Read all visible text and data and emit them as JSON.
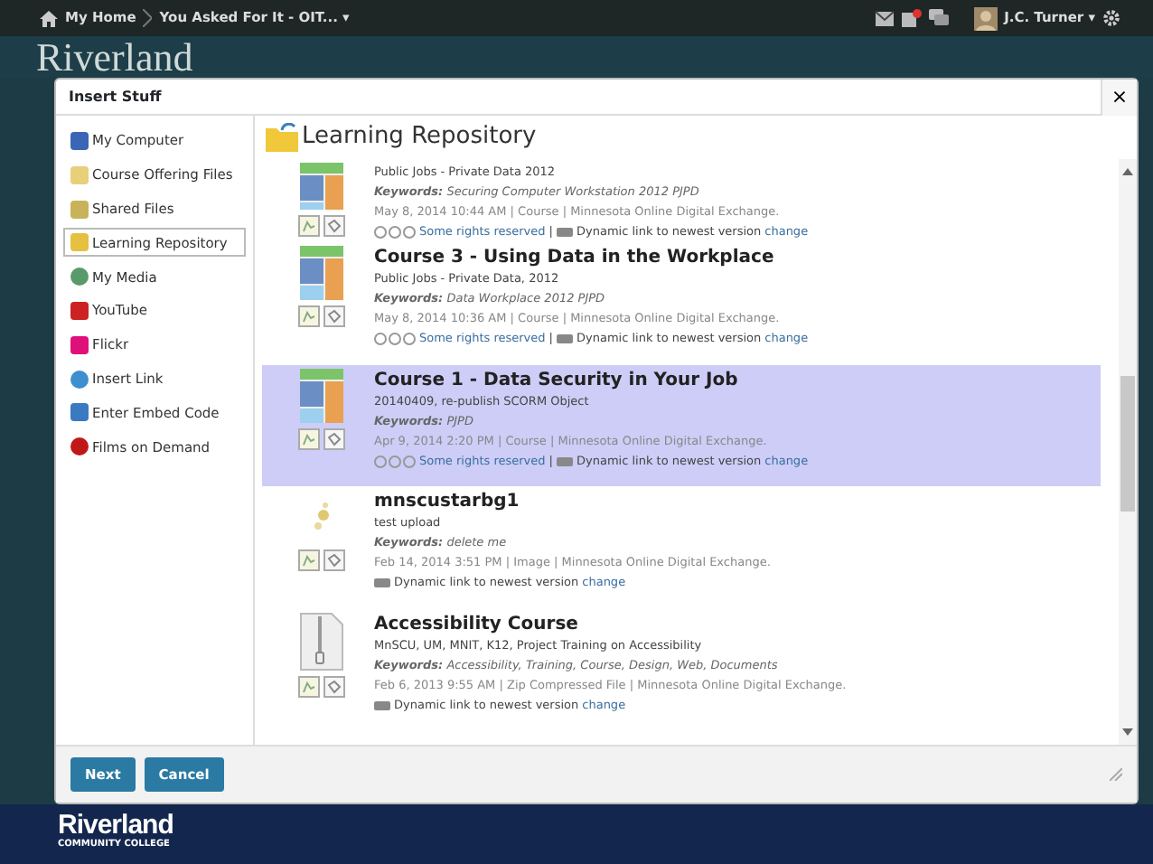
{
  "top_bar": {
    "home": "My Home",
    "course": "You Asked For It - OIT...",
    "caret": "▾",
    "user": "J.C. Turner",
    "user_caret": "▾"
  },
  "header": {
    "logo": "Riverland"
  },
  "dialog": {
    "title": "Insert Stuff",
    "close": "×",
    "sources": [
      {
        "label": "My Computer",
        "selected": false
      },
      {
        "label": "Course Offering Files",
        "selected": false
      },
      {
        "label": "Shared Files",
        "selected": false
      },
      {
        "label": "Learning Repository",
        "selected": true
      },
      {
        "label": "My Media",
        "selected": false
      },
      {
        "label": "YouTube",
        "selected": false
      },
      {
        "label": "Flickr",
        "selected": false
      },
      {
        "label": "Insert Link",
        "selected": false
      },
      {
        "label": "Enter Embed Code",
        "selected": false
      },
      {
        "label": "Films on Demand",
        "selected": false
      }
    ],
    "heading": "Learning Repository",
    "items": [
      {
        "kind": "course",
        "selected": false,
        "description": "Public Jobs - Private Data 2012",
        "keywords_label": "Keywords:",
        "keywords": "Securing Computer Workstation 2012 PJPD",
        "meta": "May 8, 2014 10:44 AM | Course | Minnesota Online Digital Exchange.",
        "rights": "Some rights reserved",
        "separator": "|",
        "link": "Dynamic link to newest version",
        "change": "change"
      },
      {
        "kind": "course",
        "selected": false,
        "title": "Course 3 - Using Data in the Workplace",
        "description": "Public Jobs - Private Data, 2012",
        "keywords_label": "Keywords:",
        "keywords": "Data Workplace 2012 PJPD",
        "meta": "May 8, 2014 10:36 AM | Course | Minnesota Online Digital Exchange.",
        "rights": "Some rights reserved",
        "separator": "|",
        "link": "Dynamic link to newest version",
        "change": "change"
      },
      {
        "kind": "course",
        "selected": true,
        "title": "Course 1 - Data Security in Your Job",
        "description": "20140409, re-publish SCORM Object",
        "keywords_label": "Keywords:",
        "keywords": "PJPD",
        "meta": "Apr 9, 2014 2:20 PM | Course | Minnesota Online Digital Exchange.",
        "rights": "Some rights reserved",
        "separator": "|",
        "link": "Dynamic link to newest version",
        "change": "change"
      },
      {
        "kind": "image",
        "selected": false,
        "title": "mnscustarbg1",
        "description": "test upload",
        "keywords_label": "Keywords:",
        "keywords": "delete me",
        "meta": "Feb 14, 2014 3:51 PM | Image | Minnesota Online Digital Exchange.",
        "link": "Dynamic link to newest version",
        "change": "change"
      },
      {
        "kind": "zip",
        "selected": false,
        "title": "Accessibility Course",
        "description": "MnSCU, UM, MNIT, K12, Project Training on Accessibility",
        "keywords_label": "Keywords:",
        "keywords": "Accessibility, Training, Course, Design, Web, Documents",
        "meta": "Feb 6, 2013 9:55 AM | Zip Compressed File | Minnesota Online Digital Exchange.",
        "link": "Dynamic link to newest version",
        "change": "change"
      }
    ],
    "buttons": [
      {
        "label": "Next"
      },
      {
        "label": "Cancel"
      }
    ]
  },
  "footer": {
    "logo": "Riverland",
    "tagline": "COMMUNITY COLLEGE"
  }
}
